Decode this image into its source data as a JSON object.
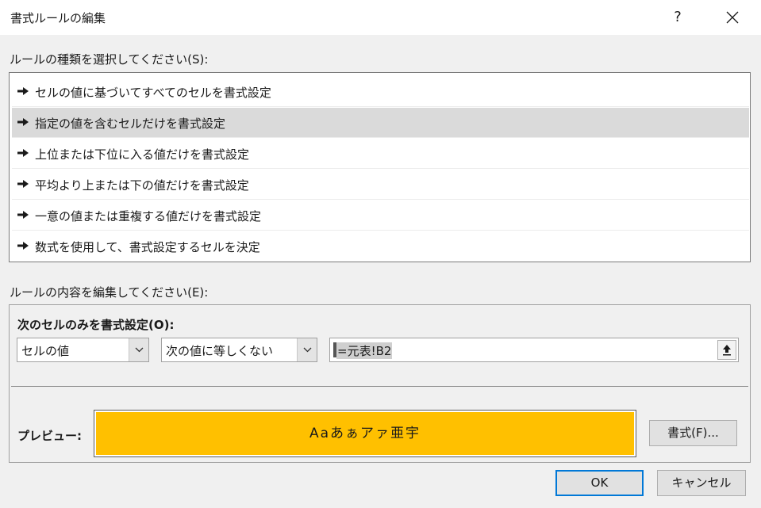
{
  "window": {
    "title": "書式ルールの編集",
    "help_label": "?"
  },
  "rule_type": {
    "label": "ルールの種類を選択してください(S):",
    "items": [
      "セルの値に基づいてすべてのセルを書式設定",
      "指定の値を含むセルだけを書式設定",
      "上位または下位に入る値だけを書式設定",
      "平均より上または下の値だけを書式設定",
      "一意の値または重複する値だけを書式設定",
      "数式を使用して、書式設定するセルを決定"
    ],
    "selected_index": 1
  },
  "rule_description": {
    "label": "ルールの内容を編集してください(E):",
    "condition_label": "次のセルのみを書式設定(O):",
    "field_select": "セルの値",
    "operator_select": "次の値に等しくない",
    "formula_value": "=元表!B2",
    "preview_label": "プレビュー:",
    "preview_text": "Aaあぁアァ亜宇",
    "preview_color": "#ffc000",
    "format_button": "書式(F)..."
  },
  "buttons": {
    "ok": "OK",
    "cancel": "キャンセル"
  }
}
